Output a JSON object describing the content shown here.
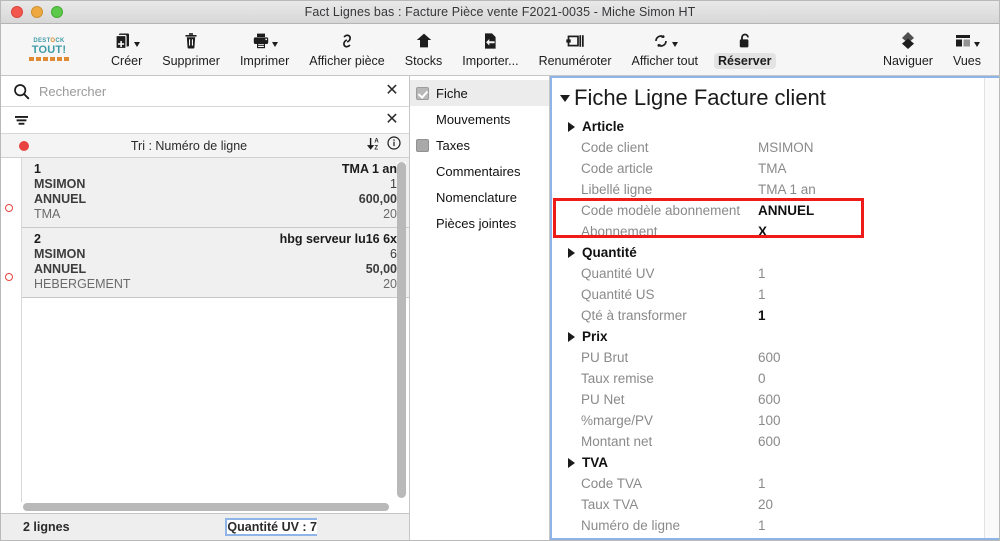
{
  "window": {
    "title": "Fact Lignes bas : Facture Pièce vente F2021-0035 - Miche Simon HT",
    "controls": [
      "close",
      "minimize",
      "zoom"
    ]
  },
  "toolbar": {
    "logo": {
      "line1_left": "DEST",
      "line1_mid": "O",
      "line1_right": "CK",
      "line2": "TOUT!"
    },
    "items": [
      {
        "label": "Créer",
        "icon": "add-document-icon",
        "has_caret": true
      },
      {
        "label": "Supprimer",
        "icon": "trash-icon",
        "has_caret": false
      },
      {
        "label": "Imprimer",
        "icon": "printer-icon",
        "has_caret": true
      },
      {
        "label": "Afficher pièce",
        "icon": "link-icon",
        "has_caret": false
      },
      {
        "label": "Stocks",
        "icon": "home-icon",
        "has_caret": false
      },
      {
        "label": "Importer...",
        "icon": "import-document-icon",
        "has_caret": false
      },
      {
        "label": "Renuméroter",
        "icon": "renumber-icon",
        "has_caret": false
      },
      {
        "label": "Afficher tout",
        "icon": "refresh-icon",
        "has_caret": true
      },
      {
        "label": "Réserver",
        "icon": "unlock-icon",
        "has_caret": false,
        "selected": true
      }
    ],
    "right_items": [
      {
        "label": "Naviguer",
        "icon": "navigate-diamond-icon",
        "has_caret": false
      },
      {
        "label": "Vues",
        "icon": "views-layout-icon",
        "has_caret": true
      }
    ]
  },
  "left_panel": {
    "search": {
      "placeholder": "Rechercher",
      "value": "",
      "icon": "search-icon",
      "clear_label": "✕"
    },
    "filter": {
      "icon": "filter-icon",
      "clear_label": "✕"
    },
    "sort": {
      "label": "Tri : Numéro de ligne",
      "sort_icon": "sort-az-icon",
      "info_icon": "info-icon"
    },
    "rows": [
      {
        "line_number": "1",
        "client": "MSIMON",
        "model": "ANNUEL",
        "article": "TMA",
        "designation": "TMA 1 an",
        "qty": "1",
        "price": "600,00",
        "vat": "20"
      },
      {
        "line_number": "2",
        "client": "MSIMON",
        "model": "ANNUEL",
        "article": "HEBERGEMENT",
        "designation": "hbg serveur lu16 6x",
        "qty": "6",
        "price": "50,00",
        "vat": "20"
      }
    ],
    "status": {
      "left": "2 lignes",
      "right": "Quantité UV : 7"
    }
  },
  "mid_panel": {
    "items": [
      {
        "label": "Fiche",
        "box": "checked",
        "active": true
      },
      {
        "label": "Mouvements",
        "box": "empty",
        "active": false
      },
      {
        "label": "Taxes",
        "box": "filled",
        "active": false
      },
      {
        "label": "Commentaires",
        "box": "empty",
        "active": false
      },
      {
        "label": "Nomenclature",
        "box": "empty",
        "active": false
      },
      {
        "label": "Pièces jointes",
        "box": "empty",
        "active": false
      }
    ]
  },
  "right_panel": {
    "title": "Fiche Ligne Facture client",
    "highlight_color": "#ee1b18",
    "sections": [
      {
        "group": "Article",
        "fields": [
          {
            "key": "Code client",
            "value": "MSIMON",
            "strong": false
          },
          {
            "key": "Code article",
            "value": "TMA",
            "strong": false
          },
          {
            "key": "Libellé ligne",
            "value": "TMA 1 an",
            "strong": false
          },
          {
            "key": "Code modèle abonnement",
            "value": "ANNUEL",
            "strong": true
          },
          {
            "key": "Abonnement",
            "value": "X",
            "strong": true
          }
        ]
      },
      {
        "group": "Quantité",
        "fields": [
          {
            "key": "Quantité UV",
            "value": "1",
            "strong": false
          },
          {
            "key": "Quantité US",
            "value": "1",
            "strong": false
          },
          {
            "key": "Qté à transformer",
            "value": "1",
            "strong": true
          }
        ]
      },
      {
        "group": "Prix",
        "fields": [
          {
            "key": "PU Brut",
            "value": "600",
            "strong": false
          },
          {
            "key": "Taux remise",
            "value": "0",
            "strong": false
          },
          {
            "key": "PU Net",
            "value": "600",
            "strong": false
          },
          {
            "key": "%marge/PV",
            "value": "100",
            "strong": false
          },
          {
            "key": "Montant net",
            "value": "600",
            "strong": false
          }
        ]
      },
      {
        "group": "TVA",
        "fields": [
          {
            "key": "Code TVA",
            "value": "1",
            "strong": false
          },
          {
            "key": "Taux TVA",
            "value": "20",
            "strong": false
          },
          {
            "key": "Numéro de ligne",
            "value": "1",
            "strong": false
          }
        ]
      }
    ]
  }
}
